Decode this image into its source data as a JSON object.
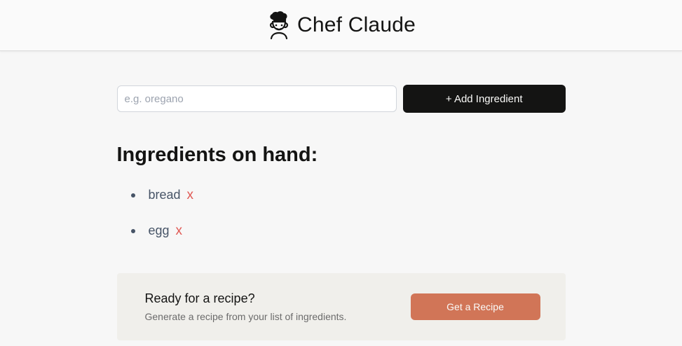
{
  "header": {
    "title": "Chef Claude",
    "logo_icon": "chef-hat-icon"
  },
  "form": {
    "placeholder": "e.g. oregano",
    "value": "",
    "add_label": "+ Add Ingredient"
  },
  "ingredients": {
    "heading": "Ingredients on hand:",
    "items": [
      {
        "name": "bread",
        "remove_label": "x"
      },
      {
        "name": "egg",
        "remove_label": "x"
      }
    ]
  },
  "cta": {
    "title": "Ready for a recipe?",
    "subtitle": "Generate a recipe from your list of ingredients.",
    "button_label": "Get a Recipe"
  },
  "colors": {
    "primary_button": "#141413",
    "accent": "#d17557",
    "remove": "#e05a55"
  }
}
